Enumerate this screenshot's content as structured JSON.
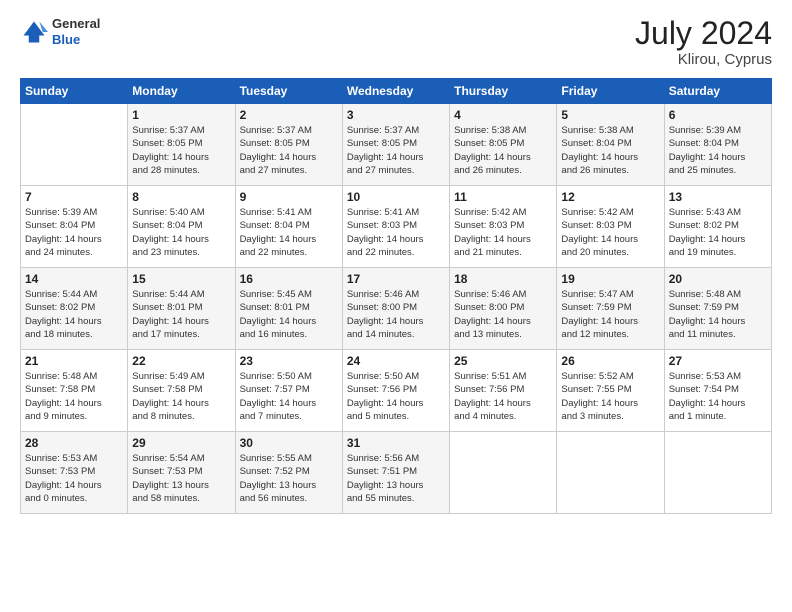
{
  "header": {
    "logo_line1": "General",
    "logo_line2": "Blue",
    "month_year": "July 2024",
    "location": "Klirou, Cyprus"
  },
  "days_of_week": [
    "Sunday",
    "Monday",
    "Tuesday",
    "Wednesday",
    "Thursday",
    "Friday",
    "Saturday"
  ],
  "weeks": [
    [
      {
        "num": "",
        "info": ""
      },
      {
        "num": "1",
        "info": "Sunrise: 5:37 AM\nSunset: 8:05 PM\nDaylight: 14 hours\nand 28 minutes."
      },
      {
        "num": "2",
        "info": "Sunrise: 5:37 AM\nSunset: 8:05 PM\nDaylight: 14 hours\nand 27 minutes."
      },
      {
        "num": "3",
        "info": "Sunrise: 5:37 AM\nSunset: 8:05 PM\nDaylight: 14 hours\nand 27 minutes."
      },
      {
        "num": "4",
        "info": "Sunrise: 5:38 AM\nSunset: 8:05 PM\nDaylight: 14 hours\nand 26 minutes."
      },
      {
        "num": "5",
        "info": "Sunrise: 5:38 AM\nSunset: 8:04 PM\nDaylight: 14 hours\nand 26 minutes."
      },
      {
        "num": "6",
        "info": "Sunrise: 5:39 AM\nSunset: 8:04 PM\nDaylight: 14 hours\nand 25 minutes."
      }
    ],
    [
      {
        "num": "7",
        "info": "Sunrise: 5:39 AM\nSunset: 8:04 PM\nDaylight: 14 hours\nand 24 minutes."
      },
      {
        "num": "8",
        "info": "Sunrise: 5:40 AM\nSunset: 8:04 PM\nDaylight: 14 hours\nand 23 minutes."
      },
      {
        "num": "9",
        "info": "Sunrise: 5:41 AM\nSunset: 8:04 PM\nDaylight: 14 hours\nand 22 minutes."
      },
      {
        "num": "10",
        "info": "Sunrise: 5:41 AM\nSunset: 8:03 PM\nDaylight: 14 hours\nand 22 minutes."
      },
      {
        "num": "11",
        "info": "Sunrise: 5:42 AM\nSunset: 8:03 PM\nDaylight: 14 hours\nand 21 minutes."
      },
      {
        "num": "12",
        "info": "Sunrise: 5:42 AM\nSunset: 8:03 PM\nDaylight: 14 hours\nand 20 minutes."
      },
      {
        "num": "13",
        "info": "Sunrise: 5:43 AM\nSunset: 8:02 PM\nDaylight: 14 hours\nand 19 minutes."
      }
    ],
    [
      {
        "num": "14",
        "info": "Sunrise: 5:44 AM\nSunset: 8:02 PM\nDaylight: 14 hours\nand 18 minutes."
      },
      {
        "num": "15",
        "info": "Sunrise: 5:44 AM\nSunset: 8:01 PM\nDaylight: 14 hours\nand 17 minutes."
      },
      {
        "num": "16",
        "info": "Sunrise: 5:45 AM\nSunset: 8:01 PM\nDaylight: 14 hours\nand 16 minutes."
      },
      {
        "num": "17",
        "info": "Sunrise: 5:46 AM\nSunset: 8:00 PM\nDaylight: 14 hours\nand 14 minutes."
      },
      {
        "num": "18",
        "info": "Sunrise: 5:46 AM\nSunset: 8:00 PM\nDaylight: 14 hours\nand 13 minutes."
      },
      {
        "num": "19",
        "info": "Sunrise: 5:47 AM\nSunset: 7:59 PM\nDaylight: 14 hours\nand 12 minutes."
      },
      {
        "num": "20",
        "info": "Sunrise: 5:48 AM\nSunset: 7:59 PM\nDaylight: 14 hours\nand 11 minutes."
      }
    ],
    [
      {
        "num": "21",
        "info": "Sunrise: 5:48 AM\nSunset: 7:58 PM\nDaylight: 14 hours\nand 9 minutes."
      },
      {
        "num": "22",
        "info": "Sunrise: 5:49 AM\nSunset: 7:58 PM\nDaylight: 14 hours\nand 8 minutes."
      },
      {
        "num": "23",
        "info": "Sunrise: 5:50 AM\nSunset: 7:57 PM\nDaylight: 14 hours\nand 7 minutes."
      },
      {
        "num": "24",
        "info": "Sunrise: 5:50 AM\nSunset: 7:56 PM\nDaylight: 14 hours\nand 5 minutes."
      },
      {
        "num": "25",
        "info": "Sunrise: 5:51 AM\nSunset: 7:56 PM\nDaylight: 14 hours\nand 4 minutes."
      },
      {
        "num": "26",
        "info": "Sunrise: 5:52 AM\nSunset: 7:55 PM\nDaylight: 14 hours\nand 3 minutes."
      },
      {
        "num": "27",
        "info": "Sunrise: 5:53 AM\nSunset: 7:54 PM\nDaylight: 14 hours\nand 1 minute."
      }
    ],
    [
      {
        "num": "28",
        "info": "Sunrise: 5:53 AM\nSunset: 7:53 PM\nDaylight: 14 hours\nand 0 minutes."
      },
      {
        "num": "29",
        "info": "Sunrise: 5:54 AM\nSunset: 7:53 PM\nDaylight: 13 hours\nand 58 minutes."
      },
      {
        "num": "30",
        "info": "Sunrise: 5:55 AM\nSunset: 7:52 PM\nDaylight: 13 hours\nand 56 minutes."
      },
      {
        "num": "31",
        "info": "Sunrise: 5:56 AM\nSunset: 7:51 PM\nDaylight: 13 hours\nand 55 minutes."
      },
      {
        "num": "",
        "info": ""
      },
      {
        "num": "",
        "info": ""
      },
      {
        "num": "",
        "info": ""
      }
    ]
  ]
}
